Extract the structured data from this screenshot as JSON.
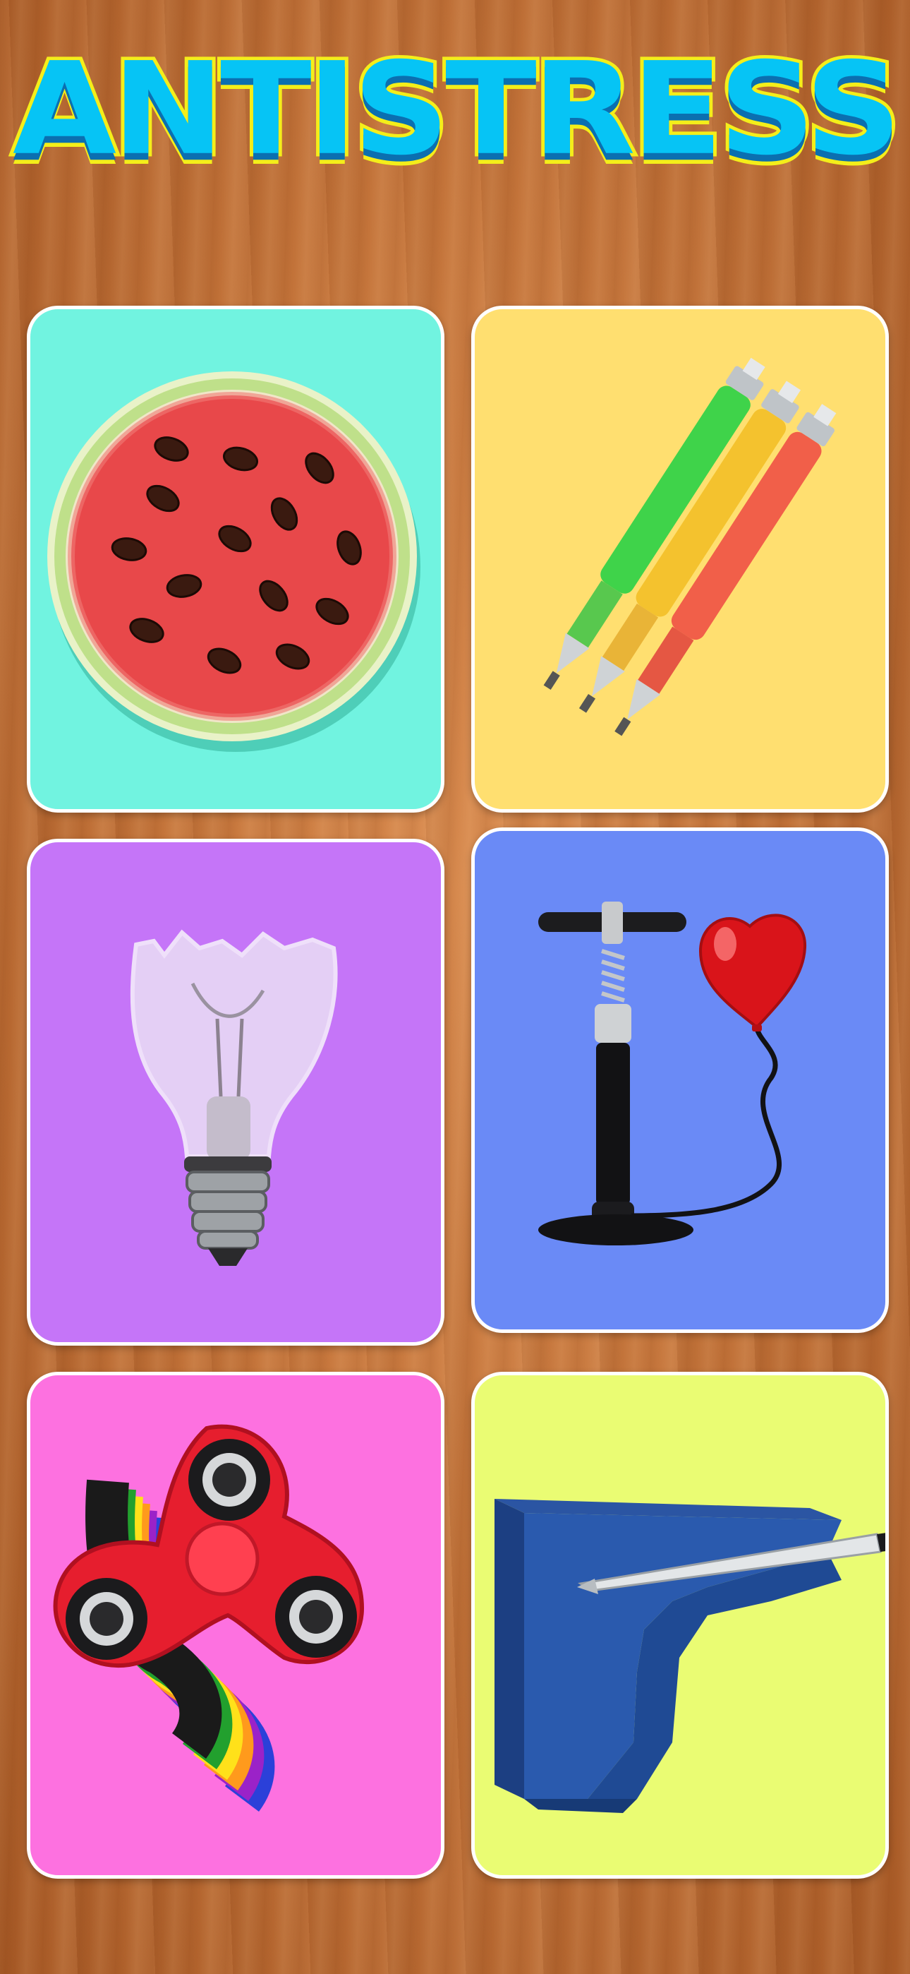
{
  "title": "ANTISTRESS",
  "games": [
    {
      "icon": "watermelon-icon",
      "bg": "#71f3e0"
    },
    {
      "icon": "pencils-icon",
      "bg": "#ffdf70"
    },
    {
      "icon": "broken-lightbulb-icon",
      "bg": "#c575f8"
    },
    {
      "icon": "air-pump-heart-balloon-icon",
      "bg": "#6a8af6"
    },
    {
      "icon": "fidget-spinner-icon",
      "bg": "#fd71e0"
    },
    {
      "icon": "foam-block-knife-icon",
      "bg": "#eafc73"
    }
  ],
  "colors": {
    "title_fill": "#06c4f5",
    "title_outline": "#f4ee1a"
  }
}
